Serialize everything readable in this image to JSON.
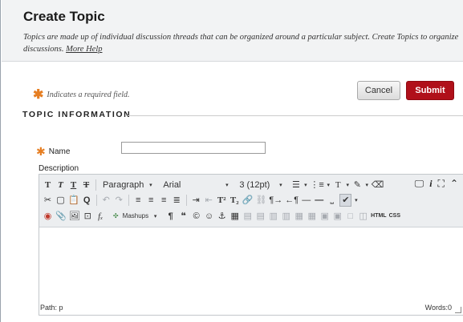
{
  "header": {
    "title": "Create Topic",
    "description": "Topics are made up of individual discussion threads that can be organized around a particular subject. Create Topics to organize discussions.",
    "help_link": "More Help"
  },
  "required_note": "Indicates a required field.",
  "buttons": {
    "cancel": "Cancel",
    "submit": "Submit"
  },
  "section": {
    "title": "TOPIC INFORMATION"
  },
  "form": {
    "name_label": "Name",
    "name_value": "",
    "description_label": "Description"
  },
  "editor": {
    "toolbar_row1": {
      "format": "Paragraph",
      "font": "Arial",
      "size": "3 (12pt)"
    },
    "mashups": "Mashups",
    "html_label": "HTML",
    "css_label": "CSS",
    "path": "Path: p",
    "words": "Words:0"
  },
  "icons": [
    "bold",
    "italic",
    "underline",
    "strikethrough",
    "cut",
    "copy",
    "paste",
    "spellcheck",
    "undo",
    "redo",
    "align-left",
    "align-center",
    "align-right",
    "justify",
    "indent",
    "outdent",
    "superscript",
    "subscript",
    "link",
    "unlink",
    "ltr",
    "rtl",
    "horizontal-rule",
    "preview",
    "fullscreen",
    "collapse",
    "insert-image",
    "attachment",
    "media",
    "equation",
    "anchor",
    "table",
    "emoticon",
    "quote",
    "copyright"
  ],
  "colors": {
    "accent": "#b0101a",
    "required_star": "#e67e22"
  }
}
